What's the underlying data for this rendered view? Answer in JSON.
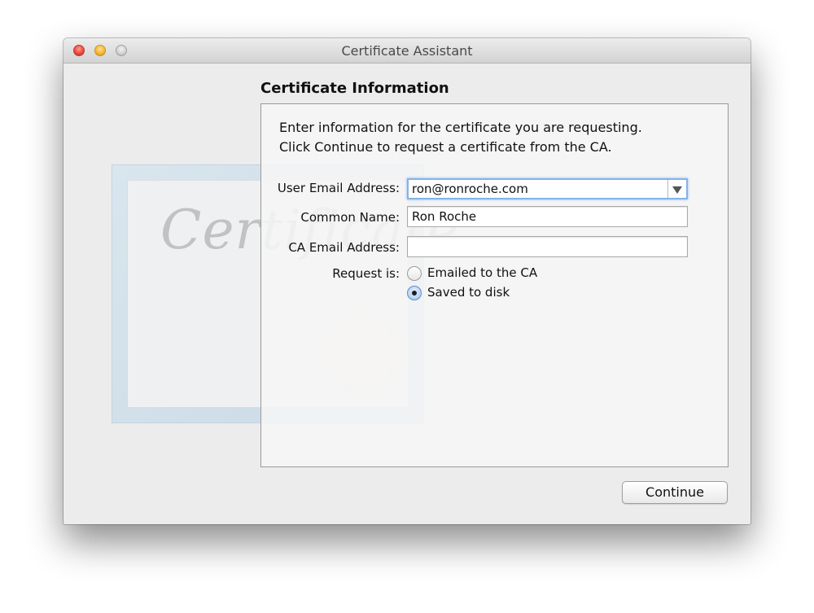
{
  "window": {
    "title": "Certificate Assistant"
  },
  "artwork": {
    "script_text": "Certificate"
  },
  "section": {
    "heading": "Certificate Information",
    "intro_line1": "Enter information for the certificate you are requesting.",
    "intro_line2": "Click Continue to request a certificate from the CA."
  },
  "form": {
    "user_email_label": "User Email Address:",
    "user_email_value": "ron@ronroche.com",
    "common_name_label": "Common Name:",
    "common_name_value": "Ron Roche",
    "ca_email_label": "CA Email Address:",
    "ca_email_value": "",
    "request_label": "Request is:",
    "request_options": [
      {
        "label": "Emailed to the CA",
        "selected": false
      },
      {
        "label": "Saved to disk",
        "selected": true
      }
    ]
  },
  "buttons": {
    "continue_label": "Continue"
  },
  "colors": {
    "focus_ring": "#83b3e6",
    "close": "#e8453b",
    "minimize": "#f2b432",
    "zoom": "#d0d0d0"
  }
}
